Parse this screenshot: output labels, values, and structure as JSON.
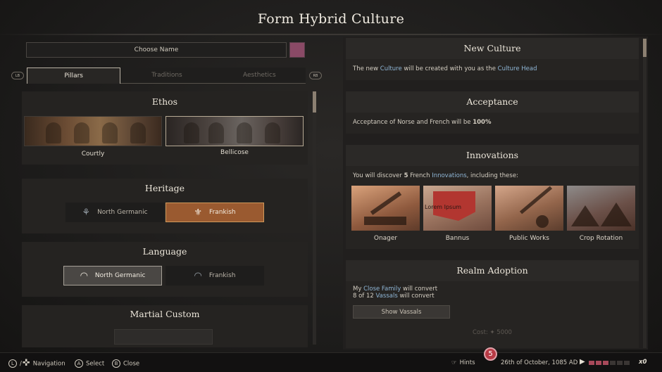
{
  "window": {
    "title": "Form Hybrid Culture"
  },
  "name_field": {
    "label": "Choose Name",
    "swatch_color": "#8a4a66"
  },
  "bumpers": {
    "left": "LB",
    "right": "RB"
  },
  "tabs": [
    {
      "label": "Pillars",
      "active": true
    },
    {
      "label": "Traditions",
      "active": false
    },
    {
      "label": "Aesthetics",
      "active": false
    }
  ],
  "ethos": {
    "heading": "Ethos",
    "options": [
      {
        "label": "Courtly",
        "selected": false
      },
      {
        "label": "Bellicose",
        "selected": true
      }
    ]
  },
  "heritage": {
    "heading": "Heritage",
    "options": [
      {
        "label": "North Germanic",
        "icon": "tree-icon",
        "selected": false
      },
      {
        "label": "Frankish",
        "icon": "fleur-icon",
        "selected": true
      }
    ]
  },
  "language": {
    "heading": "Language",
    "options": [
      {
        "label": "North Germanic",
        "icon": "lips-icon",
        "selected": true
      },
      {
        "label": "Frankish",
        "icon": "lips-icon",
        "selected": false
      }
    ]
  },
  "martial": {
    "heading": "Martial Custom"
  },
  "new_culture": {
    "heading": "New Culture",
    "text_pre": "The new ",
    "text_link1": "Culture",
    "text_mid": " will be created with you as the ",
    "text_link2": "Culture Head"
  },
  "acceptance": {
    "heading": "Acceptance",
    "text_pre": "Acceptance of Norse and French will be ",
    "value": "100%"
  },
  "innovations": {
    "heading": "Innovations",
    "text_pre": "You will discover ",
    "count": "5",
    "text_mid": " French ",
    "text_link": "Innovations",
    "text_post": ", including these:",
    "items": [
      {
        "label": "Onager"
      },
      {
        "label": "Bannus",
        "overlay": "Lorem Ipsum"
      },
      {
        "label": "Public Works"
      },
      {
        "label": "Crop Rotation"
      }
    ]
  },
  "realm": {
    "heading": "Realm Adoption",
    "line1_pre": "My ",
    "line1_link": "Close Family",
    "line1_post": " will convert",
    "line2_pre": "8 of 12 ",
    "line2_link": "Vassals",
    "line2_post": " will convert",
    "button": "Show Vassals",
    "cost_label": "Cost:",
    "cost_value": "5000"
  },
  "bottom_bar": {
    "navigation_key": "L",
    "navigation": "Navigation",
    "select_key": "A",
    "select": "Select",
    "close_key": "B",
    "close": "Close",
    "hints": "Hints",
    "hints_count": "5",
    "date": "26th of October, 1085 AD",
    "speed_label": "x0"
  }
}
